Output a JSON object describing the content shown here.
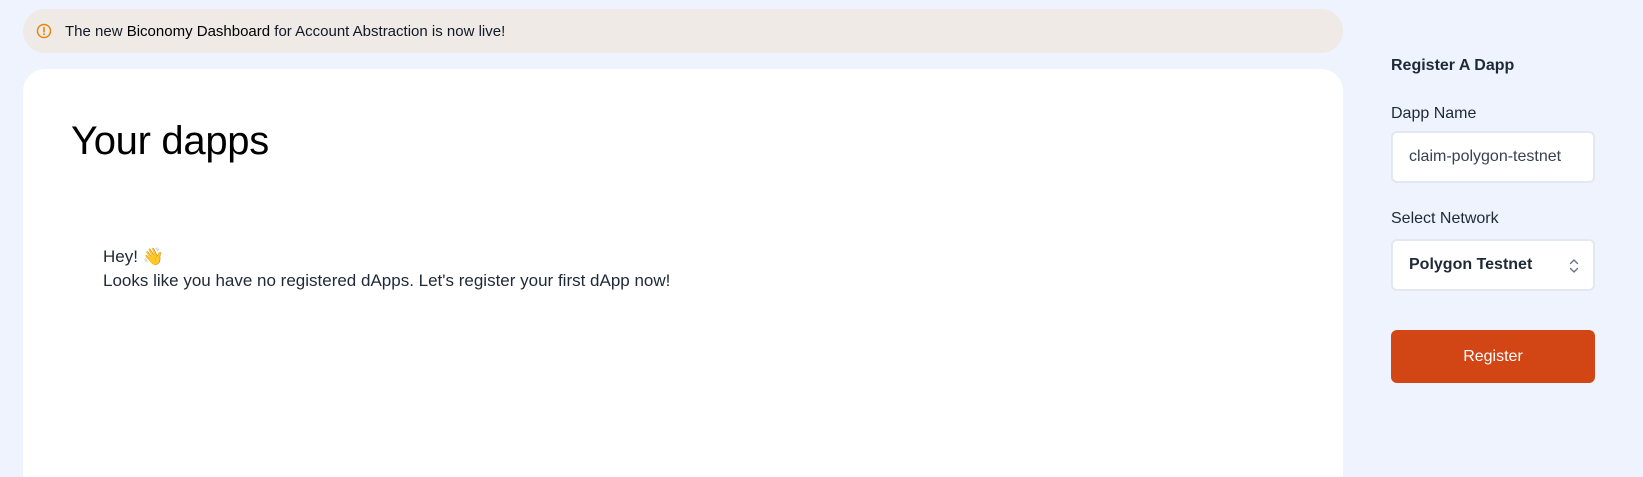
{
  "banner": {
    "icon": "alert-circle-icon",
    "prefix": "The new ",
    "link_text": "Biconomy Dashboard",
    "suffix": " for Account Abstraction is now live!"
  },
  "main": {
    "title": "Your dapps",
    "empty_greeting": "Hey! 👋",
    "empty_message": "Looks like you have no registered dApps. Let's register your first dApp now!"
  },
  "register_form": {
    "title": "Register A Dapp",
    "dapp_name_label": "Dapp Name",
    "dapp_name_value": "claim-polygon-testnet",
    "network_label": "Select Network",
    "network_selected": "Polygon Testnet",
    "submit_label": "Register"
  },
  "colors": {
    "page_bg": "#eff3fd",
    "banner_bg": "#efeae5",
    "accent": "#d24615",
    "warning_icon": "#e8870e"
  }
}
